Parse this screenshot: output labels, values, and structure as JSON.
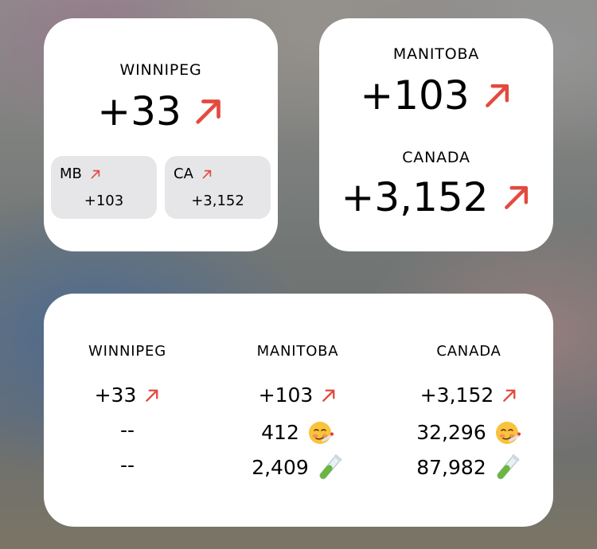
{
  "colors": {
    "arrow": "#e34a3f",
    "widget_bg": "#ffffff",
    "mini_bg": "#e6e6e8"
  },
  "icons": {
    "trend": "trend-up-arrow-icon",
    "sick": "face-with-thermometer-icon",
    "test": "test-tube-icon"
  },
  "small_widget_1": {
    "title": "WINNIPEG",
    "value": "+33",
    "mini": [
      {
        "label": "MB",
        "value": "+103"
      },
      {
        "label": "CA",
        "value": "+3,152"
      }
    ]
  },
  "small_widget_2": {
    "rows": [
      {
        "label": "MANITOBA",
        "value": "+103"
      },
      {
        "label": "CANADA",
        "value": "+3,152"
      }
    ]
  },
  "medium_widget": {
    "columns": [
      {
        "title": "WINNIPEG",
        "new_cases": "+33",
        "active": "--",
        "tests": "--"
      },
      {
        "title": "MANITOBA",
        "new_cases": "+103",
        "active": "412",
        "tests": "2,409"
      },
      {
        "title": "CANADA",
        "new_cases": "+3,152",
        "active": "32,296",
        "tests": "87,982"
      }
    ]
  }
}
